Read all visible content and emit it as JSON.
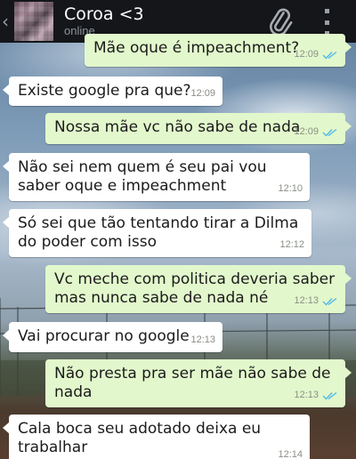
{
  "header": {
    "back_glyph": "‹",
    "contact_name": "Coroa <3",
    "status": "online",
    "icons": [
      "chevron-left-icon",
      "avatar",
      "paperclip-icon",
      "overflow-menu-icon"
    ]
  },
  "messages": [
    {
      "direction": "out",
      "text": "Mãe oque é impeachment?",
      "time": "12:09",
      "read": true
    },
    {
      "direction": "in",
      "text": "Existe google pra que?",
      "time": "12:09"
    },
    {
      "direction": "out",
      "text": "Nossa mãe vc não sabe de nada",
      "time": "12:09",
      "read": true
    },
    {
      "direction": "in",
      "text": "Não sei nem quem é seu pai vou saber oque e impeachment",
      "time": "12:10"
    },
    {
      "direction": "in",
      "text": "Só sei que tão tentando tirar a Dilma do poder com isso",
      "time": "12:12"
    },
    {
      "direction": "out",
      "text": "Vc meche com politica deveria saber mas nunca sabe de nada né",
      "time": "12:13",
      "read": true
    },
    {
      "direction": "in",
      "text": "Vai procurar no google",
      "time": "12:13"
    },
    {
      "direction": "out",
      "text": "Não presta pra ser mãe não sabe de nada",
      "time": "12:13",
      "read": true
    },
    {
      "direction": "in",
      "text": "Cala boca seu adotado deixa eu trabalhar",
      "time": "12:14"
    }
  ],
  "colors": {
    "header_bg": "#14161a",
    "incoming_bubble": "#ffffff",
    "outgoing_bubble": "#e2f8cc",
    "read_ticks": "#4fb8e8"
  }
}
